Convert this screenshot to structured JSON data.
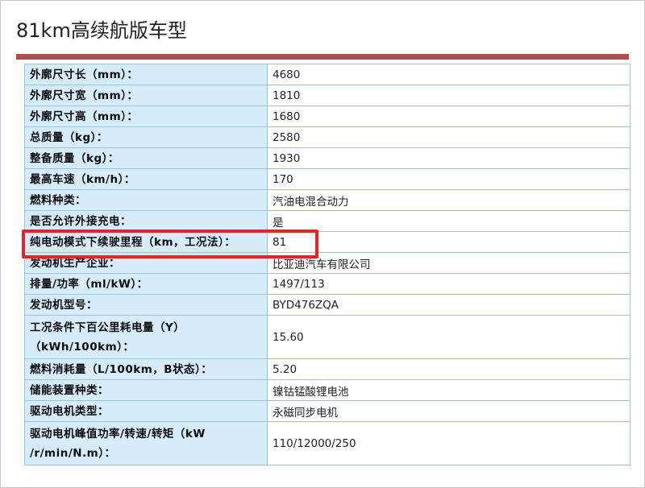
{
  "page": {
    "title": "81km高续航版车型"
  },
  "specs": {
    "rows": [
      {
        "label": "外廓尺寸长（mm）：",
        "value": "4680"
      },
      {
        "label": "外廓尺寸宽（mm）：",
        "value": "1810"
      },
      {
        "label": "外廓尺寸高（mm）：",
        "value": "1680"
      },
      {
        "label": "总质量（kg）：",
        "value": "2580"
      },
      {
        "label": "整备质量（kg）：",
        "value": "1930"
      },
      {
        "label": "最高车速（km/h）：",
        "value": "170"
      },
      {
        "label": "燃料种类：",
        "value": "汽油电混合动力"
      },
      {
        "label": "是否允许外接充电：",
        "value": "是"
      },
      {
        "label": "纯电动模式下续驶里程（km，工况法）：",
        "value": "81"
      },
      {
        "label": "发动机生产企业：",
        "value": "比亚迪汽车有限公司"
      },
      {
        "label": "排量/功率（ml/kW）：",
        "value": "1497/113"
      },
      {
        "label": "发动机型号：",
        "value": "BYD476ZQA"
      },
      {
        "label": "工况条件下百公里耗电量（Y）（kWh/100km）：",
        "value": "15.60"
      },
      {
        "label": "燃料消耗量（L/100km，B状态）：",
        "value": "5.20"
      },
      {
        "label": "储能装置种类：",
        "value": "镍钴锰酸锂电池"
      },
      {
        "label": "驱动电机类型：",
        "value": "永磁同步电机"
      },
      {
        "label": "驱动电机峰值功率/转速/转矩（kW /r/min/N.m）：",
        "value": "110/12000/250"
      }
    ]
  },
  "highlight": {
    "color": "#e5232a",
    "row_index": 8
  }
}
